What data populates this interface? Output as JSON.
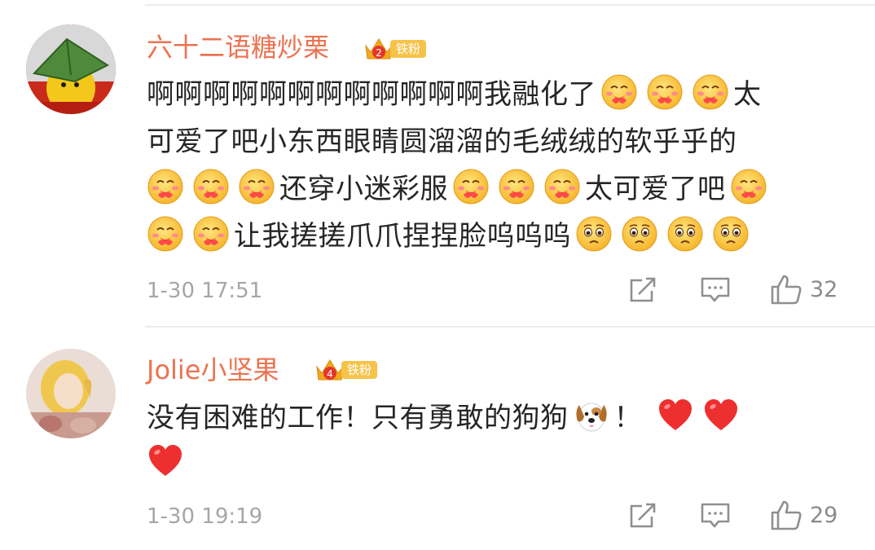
{
  "comments": [
    {
      "username": "六十二语糖炒栗",
      "badge_label": "铁粉",
      "badge_level": "2",
      "lines": {
        "l1_text": "啊啊啊啊啊啊啊啊啊啊啊啊我融化了",
        "l1_end": "太",
        "l2_text": "可爱了吧小东西眼睛圆溜溜的毛绒绒的软乎乎的",
        "l3_mid": "还穿小迷彩服",
        "l3_end": "太可爱了吧",
        "l4_text": "让我搓搓爪爪捏捏脸呜呜呜"
      },
      "time": "1-30 17:51",
      "likes": "32"
    },
    {
      "username": "Jolie小坚果",
      "badge_label": "铁粉",
      "badge_level": "4",
      "lines": {
        "l1_text": "没有困难的工作！只有勇敢的狗狗",
        "l1_end": "！"
      },
      "time": "1-30 19:19",
      "likes": "29"
    }
  ],
  "icons": {
    "hug_emoji": "hugging-face-emoji",
    "sad_emoji": "pleading-face-emoji",
    "heart_emoji": "red-heart-emoji",
    "dog_emoji": "dog-face-emoji",
    "share": "share-icon",
    "comment": "comment-icon",
    "like": "thumbs-up-icon"
  },
  "colors": {
    "username": "#eb7350",
    "badge": "#f6c34a",
    "meta": "#a6a6a6"
  }
}
